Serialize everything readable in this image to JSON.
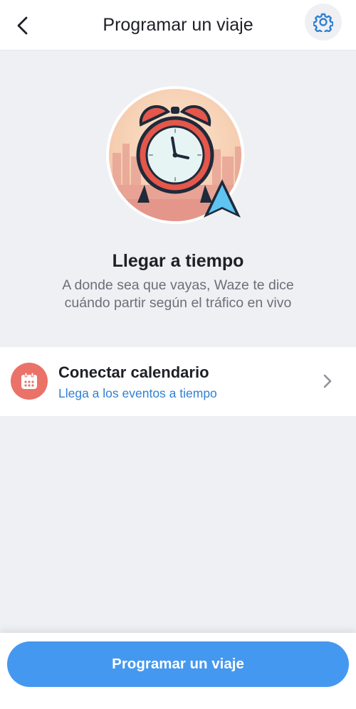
{
  "header": {
    "title": "Programar un viaje",
    "back_icon": "chevron-left-icon",
    "settings_icon": "gear-icon"
  },
  "hero": {
    "illustration": "alarm-clock-with-waze-arrow",
    "title": "Llegar a tiempo",
    "description_line1": "A donde sea que vayas, Waze te dice",
    "description_line2": "cuándo partir según el tráfico en vivo"
  },
  "calendar": {
    "icon": "calendar-icon",
    "title": "Conectar calendario",
    "subtitle": "Llega a los eventos a tiempo",
    "chevron_icon": "chevron-right-icon"
  },
  "footer": {
    "button_label": "Programar un viaje"
  },
  "colors": {
    "accent": "#4598f0",
    "link": "#2f7fd3",
    "calendar_icon_bg": "#ea7269",
    "background": "#eff0f4"
  }
}
